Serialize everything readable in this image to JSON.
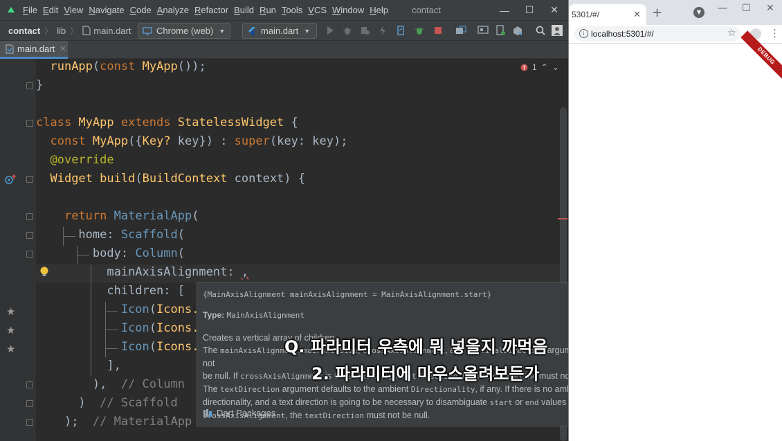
{
  "ide": {
    "menu": [
      "File",
      "Edit",
      "View",
      "Navigate",
      "Code",
      "Analyze",
      "Refactor",
      "Build",
      "Run",
      "Tools",
      "VCS",
      "Window",
      "Help"
    ],
    "project_title": "contact",
    "window_controls": {
      "minimize": "—",
      "maximize": "☐",
      "close": "✕"
    },
    "breadcrumb": {
      "project": "contact",
      "folder": "lib",
      "file": "main.dart"
    },
    "device_selector": "Chrome (web)",
    "run_config": "main.dart",
    "tab": {
      "label": "main.dart",
      "close": "✕"
    },
    "inspection": {
      "errors": "1"
    },
    "code": {
      "l1": {
        "indent": "  ",
        "a": "runApp",
        "b": "(",
        "c": "const",
        "d": " ",
        "e": "MyApp",
        "f": "());"
      },
      "l2": {
        "text": "}"
      },
      "l3": {
        "a": "class",
        "b": " MyApp ",
        "c": "extends",
        "d": " ",
        "e": "StatelessWidget",
        "f": " {"
      },
      "l4": {
        "indent": "  ",
        "a": "const",
        "b": " ",
        "c": "MyApp",
        "d": "({",
        "e": "Key?",
        "f": " key}) : ",
        "g": "super",
        "h": "(key: key);"
      },
      "l5": {
        "indent": "  ",
        "a": "@override"
      },
      "l6": {
        "indent": "  ",
        "a": "Widget",
        "b": " ",
        "c": "build",
        "d": "(",
        "e": "BuildContext",
        "f": " context) {"
      },
      "l7": {
        "indent": "    ",
        "a": "return",
        "b": " ",
        "c": "MaterialApp",
        "d": "("
      },
      "l8": {
        "indent": "      ",
        "a": "home",
        "b": ": ",
        "c": "Scaffold",
        "d": "("
      },
      "l9": {
        "indent": "        ",
        "a": "body",
        "b": ": ",
        "c": "Column",
        "d": "("
      },
      "l10": {
        "indent": "          ",
        "a": "mainAxisAlignment",
        "b": ": ",
        "c": ","
      },
      "l11": {
        "indent": "          ",
        "a": "children",
        "b": ": ["
      },
      "l12": {
        "indent": "            ",
        "a": "Icon",
        "b": "(",
        "c": "Icons."
      },
      "l13": {
        "indent": "            ",
        "a": "Icon",
        "b": "(",
        "c": "Icons."
      },
      "l14": {
        "indent": "            ",
        "a": "Icon",
        "b": "(",
        "c": "Icons."
      },
      "l15": {
        "indent": "          ",
        "a": "],"
      },
      "l16": {
        "indent": "        ",
        "a": "),",
        "b": "  // Column"
      },
      "l17": {
        "indent": "      ",
        "a": ")",
        "b": "  // Scaffold"
      },
      "l18": {
        "indent": "    ",
        "a": ");",
        "b": "  // MaterialApp"
      }
    }
  },
  "doc_popup": {
    "signature": "{MainAxisAlignment mainAxisAlignment = MainAxisAlignment.start}",
    "type_label": "Type:",
    "type_value": "MainAxisAlignment",
    "desc1": "Creates a vertical array of children.",
    "desc2a": "The ",
    "desc2b": "mainAxisAlignment",
    "desc2c": ", ",
    "desc2d": "mainAxisSize",
    "desc2e": ", ",
    "desc2f": "crossAxisAlignment",
    "desc2g": ", and ",
    "desc2h": "verticalDirection",
    "desc2i": " arguments must not",
    "desc3a": "be null. If ",
    "desc3b": "crossAxisAlignment",
    "desc3c": " is ",
    "desc3d": "CrossAxisAlignment.baseline",
    "desc3e": ", then ",
    "desc3f": "textBaseline",
    "desc3g": " must not be null.",
    "desc4a": "The ",
    "desc4b": "textDirection",
    "desc4c": " argument defaults to the ambient ",
    "desc4d": "Directionality",
    "desc4e": ", if any. If there is no ambient",
    "desc5a": "directionality, and a text direction is going to be necessary to disambiguate ",
    "desc5b": "start",
    "desc5c": " or ",
    "desc5d": "end",
    "desc5e": " values for the",
    "desc6a": "crossAxisAlignment",
    "desc6b": ", the ",
    "desc6c": "textDirection",
    "desc6d": " must not be null.",
    "footer": "Dart Packages",
    "more": "⋮"
  },
  "subtitles": {
    "line1": "Q. 파라미터 우측에 뭐 넣을지 까먹음",
    "line2": "2. 파라미터에 마우스올려보든가"
  },
  "browser": {
    "tab_title": "5301/#/",
    "tab_close": "✕",
    "new_tab": "+",
    "url": "localhost:5301/#/",
    "star": "☆",
    "menu": "⋮",
    "window_controls": {
      "minimize": "—",
      "maximize": "☐",
      "close": "✕"
    },
    "debug_banner": "DEBUG"
  },
  "colors": {
    "editor_bg": "#2b2b2b",
    "keyword": "#cc7832",
    "function": "#ffc66d",
    "class_name": "#6897bb",
    "comment": "#808080",
    "annotation": "#bbb529",
    "debug_banner": "#b71c1c"
  }
}
